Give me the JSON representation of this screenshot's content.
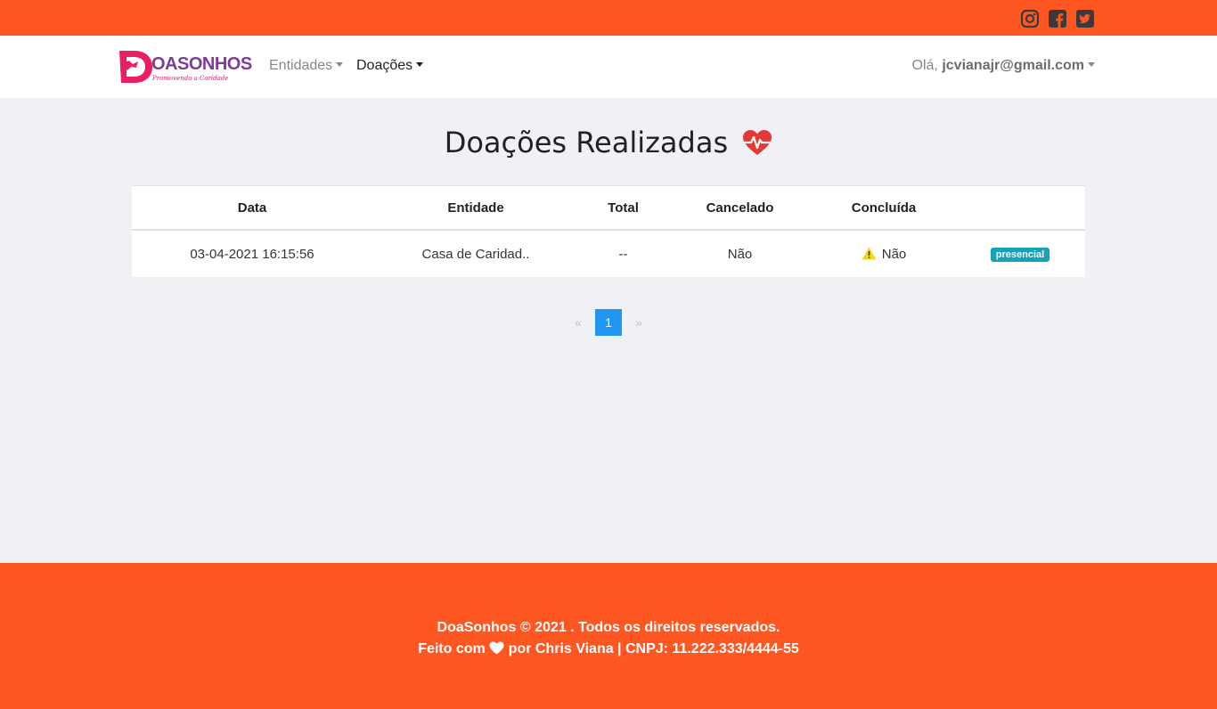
{
  "social": {
    "icons": [
      "instagram-icon",
      "facebook-icon",
      "twitter-icon"
    ]
  },
  "brand": {
    "name": "OASONHOS",
    "tagline": "Promovendo a Caridade"
  },
  "nav": {
    "entidades": "Entidades",
    "doacoes": "Doações",
    "greeting": "Olá, ",
    "user": "jcvianajr@gmail.com"
  },
  "page": {
    "title": "Doações Realizadas"
  },
  "table": {
    "headers": [
      "Data",
      "Entidade",
      "Total",
      "Cancelado",
      "Concluída",
      ""
    ],
    "rows": [
      {
        "data": "03-04-2021 16:15:56",
        "entidade": "Casa de Caridad..",
        "total": "--",
        "cancelado": "Não",
        "concluida": "Não",
        "tipo": "presencial"
      }
    ]
  },
  "pagination": {
    "prev": "«",
    "current": "1",
    "next": "»"
  },
  "footer": {
    "line1": "DoaSonhos © 2021 . Todos os direitos reservados.",
    "line2_pre": "Feito com ",
    "line2_post": " por Chris Viana | CNPJ: 11.222.333/4444-55"
  },
  "colors": {
    "accent": "#ff5722",
    "badge": "#17a2b8",
    "pager_active": "#2196f3",
    "heart": "#e53935"
  }
}
